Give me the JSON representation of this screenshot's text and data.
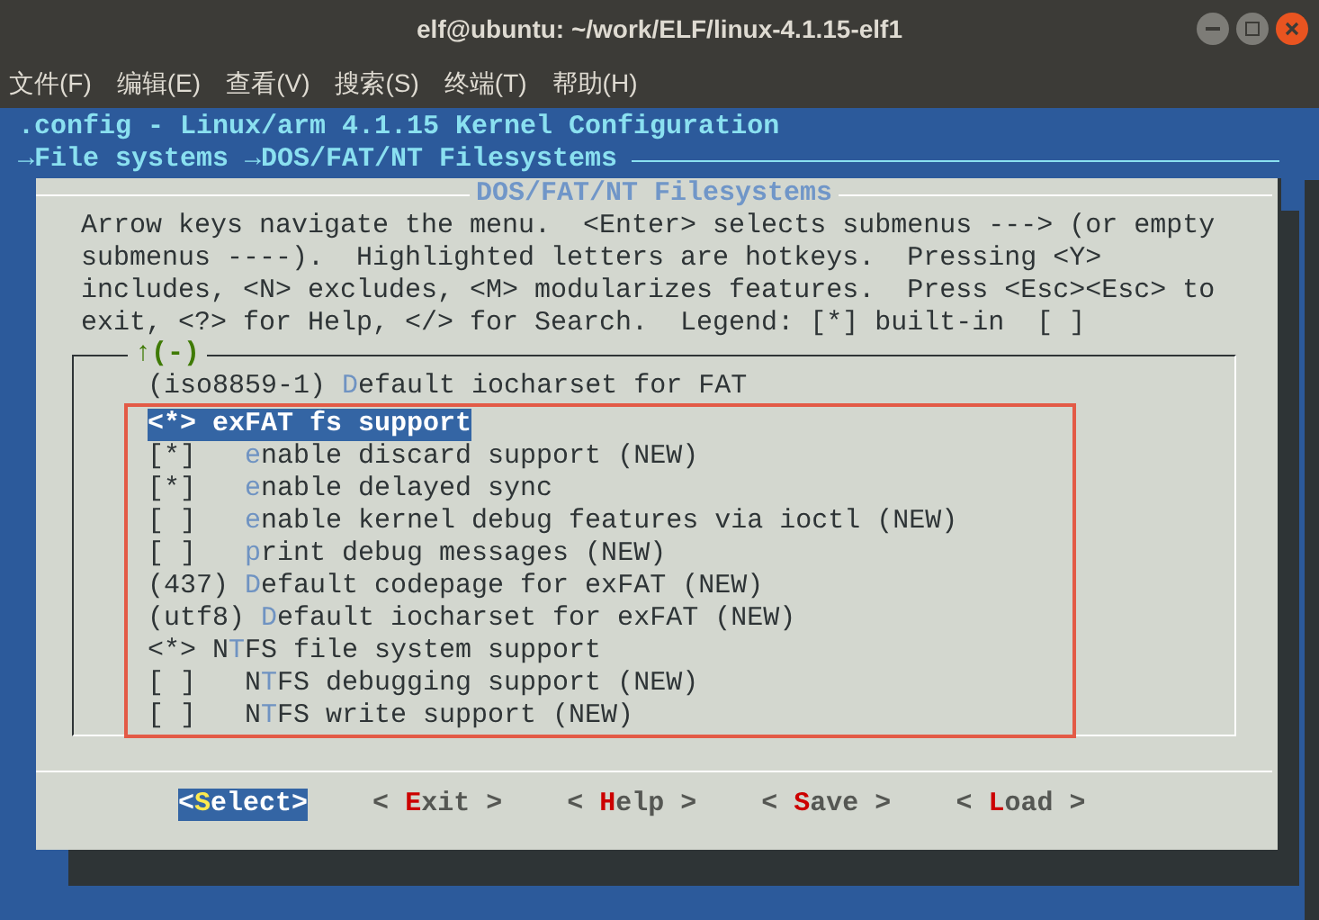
{
  "window": {
    "title": "elf@ubuntu: ~/work/ELF/linux-4.1.15-elf1"
  },
  "menu": [
    "文件(F)",
    "编辑(E)",
    "查看(V)",
    "搜索(S)",
    "终端(T)",
    "帮助(H)"
  ],
  "header": {
    "title": ".config - Linux/arm 4.1.15 Kernel Configuration",
    "breadcrumb": "→File systems →DOS/FAT/NT Filesystems"
  },
  "dialog": {
    "title": "DOS/FAT/NT Filesystems",
    "help": [
      "Arrow keys navigate the menu.  <Enter> selects submenus ---> (or empty",
      "submenus ----).  Highlighted letters are hotkeys.  Pressing <Y>",
      "includes, <N> excludes, <M> modularizes features.  Press <Esc><Esc> to",
      "exit, <?> for Help, </> for Search.  Legend: [*] built-in  [ ]"
    ],
    "scroll_indicator": "↑(-)",
    "items": [
      {
        "prefix": "(iso8859-1) ",
        "hotkey": "D",
        "rest": "efault iocharset for FAT",
        "selected": false
      }
    ],
    "annotation": {
      "items": [
        {
          "prefix": "<*> ",
          "hotkey": "e",
          "rest": "xFAT fs support",
          "selected": true
        },
        {
          "prefix": "[*]   ",
          "hotkey": "e",
          "rest": "nable discard support (NEW)",
          "selected": false
        },
        {
          "prefix": "[*]   ",
          "hotkey": "e",
          "rest": "nable delayed sync",
          "selected": false
        },
        {
          "prefix": "[ ]   ",
          "hotkey": "e",
          "rest": "nable kernel debug features via ioctl (NEW)",
          "selected": false
        },
        {
          "prefix": "[ ]   ",
          "hotkey": "p",
          "rest": "rint debug messages (NEW)",
          "selected": false
        },
        {
          "prefix": "(437) ",
          "hotkey": "D",
          "rest": "efault codepage for exFAT (NEW)",
          "selected": false
        },
        {
          "prefix": "(utf8) ",
          "hotkey": "D",
          "rest": "efault iocharset for exFAT (NEW)",
          "selected": false
        },
        {
          "prefix": "<*> N",
          "hotkey": "T",
          "rest": "FS file system support",
          "selected": false
        },
        {
          "prefix": "[ ]   N",
          "hotkey": "T",
          "rest": "FS debugging support (NEW)",
          "selected": false
        },
        {
          "prefix": "[ ]   N",
          "hotkey": "T",
          "rest": "FS write support (NEW)",
          "selected": false
        }
      ]
    },
    "buttons": [
      {
        "prefix": "<",
        "hotkey": "S",
        "rest": "elect>",
        "selected": true
      },
      {
        "prefix": "< ",
        "hotkey": "E",
        "rest": "xit >",
        "selected": false
      },
      {
        "prefix": "< ",
        "hotkey": "H",
        "rest": "elp >",
        "selected": false
      },
      {
        "prefix": "< ",
        "hotkey": "S",
        "rest": "ave >",
        "selected": false
      },
      {
        "prefix": "< ",
        "hotkey": "L",
        "rest": "oad >",
        "selected": false
      }
    ]
  }
}
